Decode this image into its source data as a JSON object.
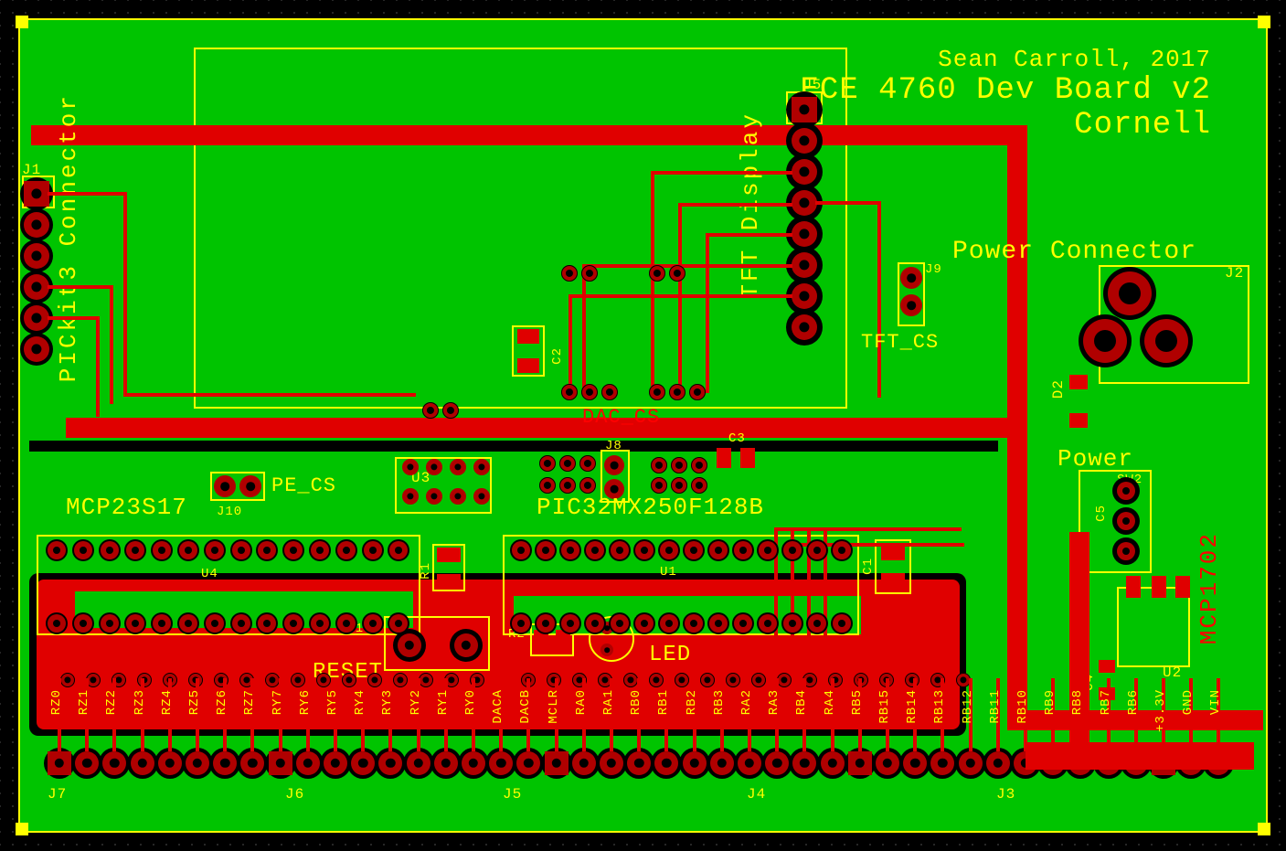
{
  "meta": {
    "author": "Sean Carroll, 2017",
    "title": "ECE 4760 Dev Board v2",
    "org": "Cornell"
  },
  "labels": {
    "pickit": "PICkit3 Connector",
    "tft": "TFT Display",
    "power_conn": "Power Connector",
    "tft_cs": "TFT_CS",
    "pe_cs": "PE_CS",
    "dac_cs": "DAC_CS",
    "mcp23s17": "MCP23S17",
    "pic32": "PIC32MX250F128B",
    "reset": "RESET",
    "led": "LED",
    "power": "Power",
    "mcp1702": "MCP1702"
  },
  "refs": {
    "J1": "J1",
    "J2": "J2",
    "J3": "J3",
    "J4": "J4",
    "J5": "J5",
    "J6": "J6",
    "J7": "J7",
    "J8": "J8",
    "J9": "J9",
    "J10": "J10",
    "U1": "U1",
    "U2": "U2",
    "U3": "U3",
    "U4": "U4",
    "U5": "U5",
    "C1": "C1",
    "C2": "C2",
    "C3": "C3",
    "C4": "C4",
    "C5": "C5",
    "R1": "R1",
    "R2": "R2",
    "D1": "D1",
    "D2": "D2",
    "SW1": "SW1",
    "SW2": "SW2"
  },
  "pins": {
    "bottom": [
      "RZ0",
      "RZ1",
      "RZ2",
      "RZ3",
      "RZ4",
      "RZ5",
      "RZ6",
      "RZ7",
      "RY7",
      "RY6",
      "RY5",
      "RY4",
      "RY3",
      "RY2",
      "RY1",
      "RY0",
      "DACA",
      "DACB",
      "MCLR",
      "RA0",
      "RA1",
      "RB0",
      "RB1",
      "RB2",
      "RB3",
      "RA2",
      "RA3",
      "RB4",
      "RA4",
      "RB5",
      "RB15",
      "RB14",
      "RB13",
      "RB12",
      "RB11",
      "RB10",
      "RB9",
      "RB8",
      "RB7",
      "RB6",
      "+3.3V",
      "GND",
      "VIN"
    ]
  }
}
